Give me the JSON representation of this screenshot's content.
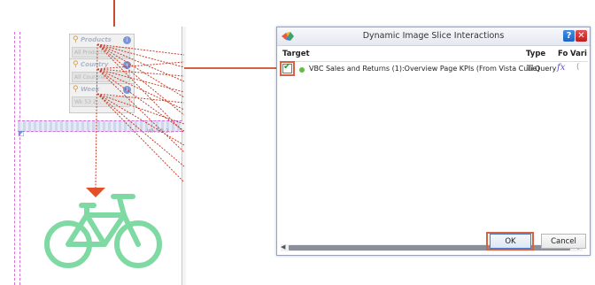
{
  "colors": {
    "annotation": "#d6633f",
    "bicycle": "#7fd9a3",
    "dialog_border": "#9aa3b5",
    "ok_border": "#4b7bc5"
  },
  "canvas": {
    "selectors": [
      {
        "title": "Products",
        "field": "All Products",
        "badge": "i",
        "icon": "filter-icon"
      },
      {
        "title": "Country",
        "field": "All Countries",
        "badge": "i",
        "icon": "filter-icon"
      },
      {
        "title": "Week",
        "field": "Wk 53 2...",
        "badge": "i",
        "icon": "filter-icon"
      }
    ],
    "strip_text": "Wk 53 2...",
    "image_icon": "bicycle-icon"
  },
  "dialog": {
    "title": "Dynamic Image Slice Interactions",
    "help_label": "?",
    "close_label": "✕",
    "columns": {
      "target": "Target",
      "type": "Type",
      "fo": "Fo",
      "vari": "Vari"
    },
    "rows": [
      {
        "checked": true,
        "status_color": "#5fbf3c",
        "target": "VBC Sales and Returns (1):Overview Page KPIs (From Vista Cube)",
        "type": "Query",
        "formula_icon": "fx",
        "variable_icon": "("
      }
    ],
    "ok_label": "OK",
    "cancel_label": "Cancel"
  }
}
